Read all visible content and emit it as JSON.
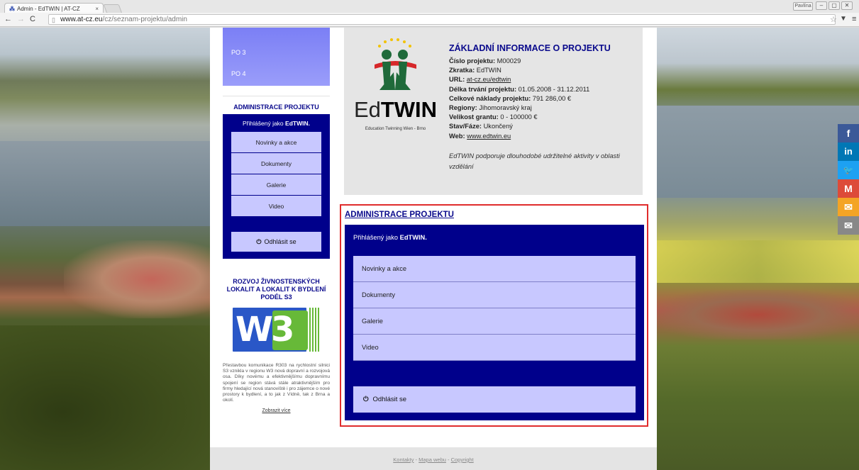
{
  "browser": {
    "tab_title": "Admin - EdTWIN | AT-CZ",
    "tab_close": "×",
    "profile": "Pavlína",
    "url_host": "www.at-cz.eu",
    "url_path": "/cz/seznam-projektu/admin"
  },
  "sidebar": {
    "po_items": [
      "PO 3",
      "PO 4"
    ],
    "admin_title": "ADMINISTRACE PROJEKTU",
    "logged_prefix": "Přihlášený jako ",
    "logged_user": "EdTWIN.",
    "menu": [
      "Novinky a akce",
      "Dokumenty",
      "Galerie",
      "Video"
    ],
    "logout": "Odhlásit se",
    "rozvoj_title": "ROZVOJ ŽIVNOSTENSKÝCH LOKALIT A LOKALIT K BYDLENÍ PODÉL S3",
    "rozvoj_logo": "W3",
    "rozvoj_text": "Přestavbou komunikace R303 na rychlostní silnici S3 vznikla v regionu W3 nová dopravní a rozvojová osa. Díky novému a efektivnějšímu dopravnímu spojení se region stává stále atraktivnějším pro firmy hledající nová stanoviště i pro zájemce o nové prostory k bydlení, a to jak z Vídně, tak z Brna a okolí.",
    "show_more": "Zobrazit více"
  },
  "project": {
    "logo_word_light": "Ed",
    "logo_word_bold": "TWIN",
    "logo_subtitle": "Education Twinning  Wien - Brno",
    "heading": "ZÁKLADNÍ INFORMACE O PROJEKTU",
    "rows": [
      {
        "label": "Číslo projektu:",
        "value": " M00029"
      },
      {
        "label": "Zkratka:",
        "value": " EdTWIN"
      },
      {
        "label": "URL:",
        "link": "at-cz.eu/edtwin"
      },
      {
        "label": "Délka trvání projektu:",
        "value": " 01.05.2008 - 31.12.2011"
      },
      {
        "label": "Celkové náklady projektu:",
        "value": " 791 286,00 €"
      },
      {
        "label": "Regiony:",
        "value": " Jihomoravský kraj"
      },
      {
        "label": "Velikost grantu:",
        "value": " 0 - 100000 €"
      },
      {
        "label": "Stav/Fáze:",
        "value": " Ukončený"
      },
      {
        "label": "Web:",
        "link": "www.edtwin.eu"
      }
    ],
    "description": "EdTWIN podporuje dlouhodobé udržitelné aktivity v oblasti vzdělání"
  },
  "admin": {
    "heading": "ADMINISTRACE PROJEKTU",
    "logged_prefix": "Přihlášený jako ",
    "logged_user": "EdTWIN.",
    "menu": [
      "Novinky a akce",
      "Dokumenty",
      "Galerie",
      "Video"
    ],
    "logout": "Odhlásit se",
    "highlight_color": "#e02c2c"
  },
  "footer": {
    "links": [
      "Kontakty",
      "Mapa webu",
      "Copyright"
    ],
    "separator": " - "
  },
  "social": [
    {
      "icon": "facebook-icon",
      "glyph": "f",
      "color": "#3b5998"
    },
    {
      "icon": "linkedin-icon",
      "glyph": "in",
      "color": "#0077b5"
    },
    {
      "icon": "twitter-icon",
      "glyph": "🐦",
      "color": "#1da1f2"
    },
    {
      "icon": "gmail-icon",
      "glyph": "M",
      "color": "#dd4b39"
    },
    {
      "icon": "email-icon",
      "glyph": "✉",
      "color": "#f4a425"
    },
    {
      "icon": "email-plain-icon",
      "glyph": "✉",
      "color": "#888888"
    }
  ]
}
